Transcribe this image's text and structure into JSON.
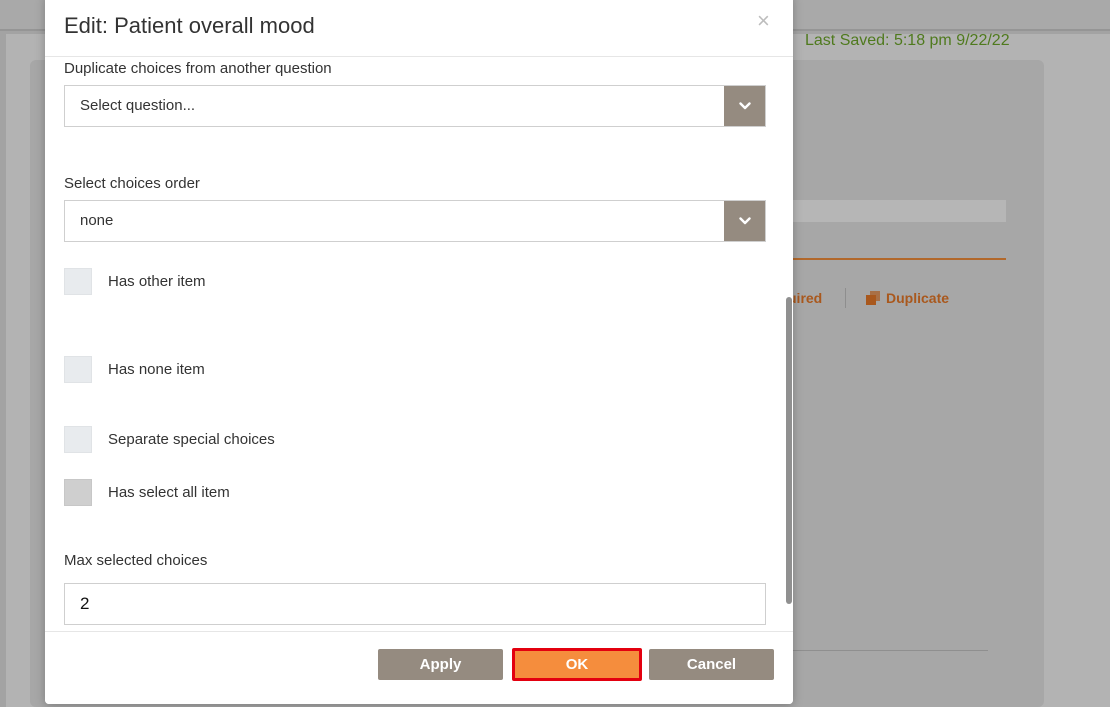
{
  "background": {
    "last_saved": "Last Saved: 5:18 pm 9/22/22",
    "required_fragment": "uired",
    "duplicate_label": "Duplicate"
  },
  "modal": {
    "title": "Edit: Patient overall mood",
    "close_icon": "×",
    "duplicate_choices_label": "Duplicate choices from another question",
    "duplicate_choices_value": "Select question...",
    "choices_order_label": "Select choices order",
    "choices_order_value": "none",
    "checkboxes": {
      "has_other_item": "Has other item",
      "has_none_item": "Has none item",
      "separate_special_choices": "Separate special choices",
      "has_select_all_item": "Has select all item"
    },
    "max_selected_label": "Max selected choices",
    "max_selected_value": "2",
    "buttons": {
      "apply": "Apply",
      "ok": "OK",
      "cancel": "Cancel"
    }
  },
  "colors": {
    "accent_orange": "#f58d3d",
    "highlight_red": "#e3000f",
    "button_gray": "#958b80",
    "last_saved_green": "#4f7a1e"
  },
  "icons": {
    "close": "close-icon",
    "dropdown": "chevron-down-icon",
    "duplicate": "duplicate-icon"
  }
}
